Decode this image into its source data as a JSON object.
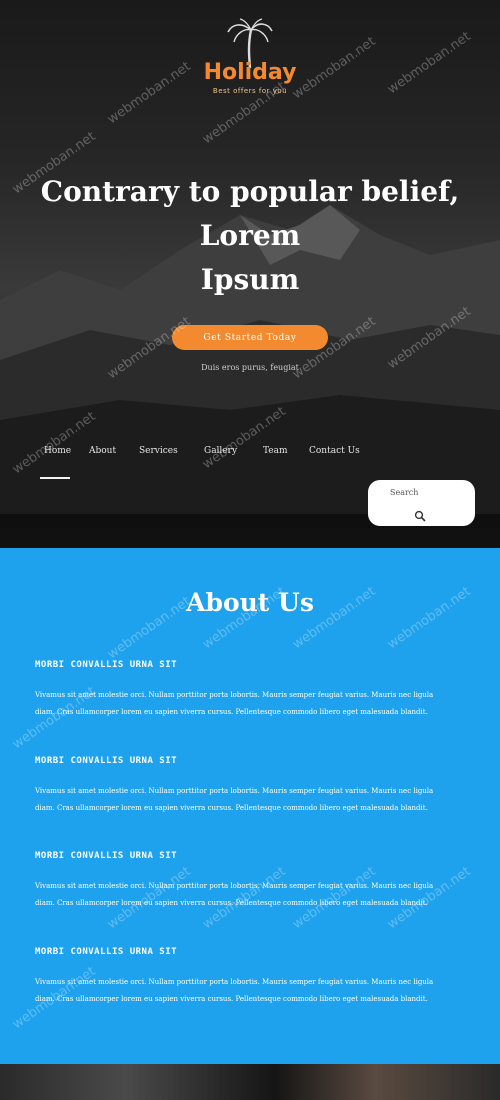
{
  "header": {
    "brand": "Holiday",
    "tagline": "Best offers for you",
    "logo_icon": "palm-tree-icon"
  },
  "hero": {
    "headline_line1": "Contrary to popular belief,",
    "headline_line2": "Lorem",
    "headline_line3": "Ipsum",
    "cta_label": "Get Started Today",
    "subline": "Duis eros purus, feugiat"
  },
  "nav": {
    "items": [
      "Home",
      "About",
      "Services",
      "Gallery",
      "Team",
      "Contact Us"
    ],
    "active": "Home"
  },
  "search": {
    "label": "Search",
    "icon": "search-icon"
  },
  "about": {
    "title": "About Us",
    "blocks": [
      {
        "heading": "MORBI CONVALLIS URNA SIT",
        "text": "Vivamus sit amet molestie orci. Nullam porttitor porta lobortis. Mauris semper feugiat varius. Mauris nec ligula diam. Cras ullamcorper lorem eu sapien viverra cursus. Pellentesque commodo libero eget malesuada blandit."
      },
      {
        "heading": "MORBI CONVALLIS URNA SIT",
        "text": "Vivamus sit amet molestie orci. Nullam porttitor porta lobortis. Mauris semper feugiat varius. Mauris nec ligula diam. Cras ullamcorper lorem eu sapien viverra cursus. Pellentesque commodo libero eget malesuada blandit."
      },
      {
        "heading": "MORBI CONVALLIS URNA SIT",
        "text": "Vivamus sit amet molestie orci. Nullam porttitor porta lobortis. Mauris semper feugiat varius. Mauris nec ligula diam. Cras ullamcorper lorem eu sapien viverra cursus. Pellentesque commodo libero eget malesuada blandit."
      },
      {
        "heading": "MORBI CONVALLIS URNA SIT",
        "text": "Vivamus sit amet molestie orci. Nullam porttitor porta lobortis. Mauris semper feugiat varius. Mauris nec ligula diam. Cras ullamcorper lorem eu sapien viverra cursus. Pellentesque commodo libero eget malesuada blandit."
      }
    ]
  },
  "watermark": "webmoban.net",
  "colors": {
    "accent": "#f38a2f",
    "about_bg": "#1fa2ee",
    "hero_bg": "#262626"
  }
}
